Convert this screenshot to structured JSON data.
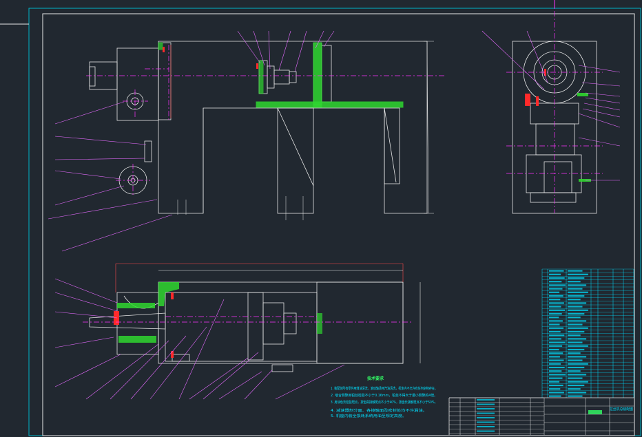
{
  "drawing": {
    "technical_requirements": {
      "heading": "技术要求",
      "lines": [
        "1. 装配前所有零件用煤油清洗，滚动轴承用汽油清洗，机体内不允许有任何杂物存在。",
        "2. 啮合侧隙用铅丝检验不小于0.16mm，铅丝不得大于最小侧隙的4倍。",
        "3. 用涂色法检验斑点，按齿高接触斑点不小于40%，按齿长接触斑点不小于50%。",
        "4. 减速器剖分面、各接触面及密封处均不许漏油。",
        "5. 机座内装全损耗系统用油至规定高度。"
      ]
    },
    "title_block": {
      "name": "拉丝机总装配图"
    }
  },
  "colors": {
    "background": "#212830",
    "frame": "#00b4c8",
    "outline": "#e8e8e8",
    "centerline": "#ff33ff",
    "hatch": "#2fd62f",
    "highlight": "#ff2a2a",
    "dimension": "#ff4b4b",
    "table": "#00e0ff",
    "leader": "#e66bff",
    "note_text": "#33ff66"
  }
}
